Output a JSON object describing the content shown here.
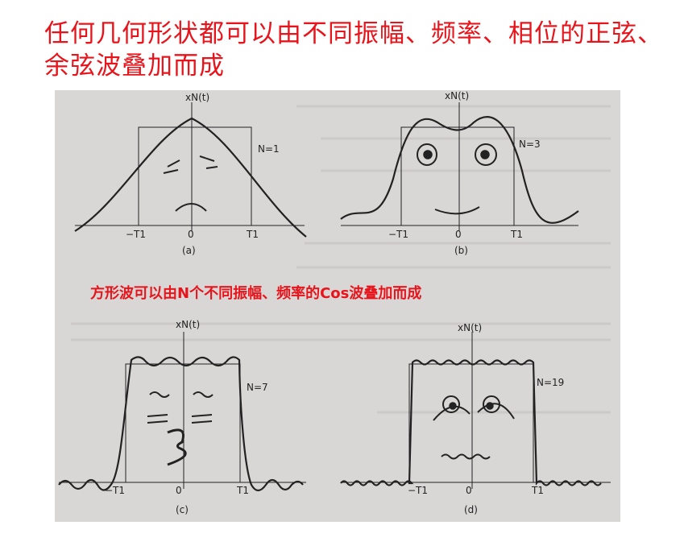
{
  "title": "任何几何形状都可以由不同振幅、频率、相位的正弦、余弦波叠加而成",
  "caption": "方形波可以由N个不同振幅、频率的Cos波叠加而成",
  "panels": [
    {
      "ylabel": "xN(t)",
      "n_label": "N=1",
      "neg_tick": "−T1",
      "zero_tick": "0",
      "pos_tick": "T1",
      "sublabel": "(a)"
    },
    {
      "ylabel": "xN(t)",
      "n_label": "N=3",
      "neg_tick": "−T1",
      "zero_tick": "0",
      "pos_tick": "T1",
      "sublabel": "(b)"
    },
    {
      "ylabel": "xN(t)",
      "n_label": "N=7",
      "neg_tick": "−T1",
      "zero_tick": "0",
      "pos_tick": "T1",
      "sublabel": "(c)"
    },
    {
      "ylabel": "xN(t)",
      "n_label": "N=19",
      "neg_tick": "−T1",
      "zero_tick": "0",
      "pos_tick": "T1",
      "sublabel": "(d)"
    }
  ]
}
